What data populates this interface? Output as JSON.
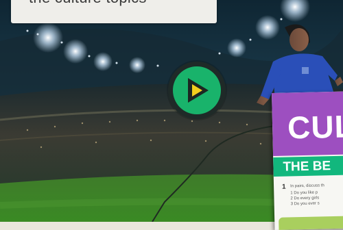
{
  "caption": {
    "text": "the culture topics"
  },
  "video": {
    "play_label": "Play video",
    "icon": "play-icon"
  },
  "card": {
    "title": "CUL",
    "subtitle": "THE BE",
    "item_number": "1",
    "lines": [
      "In pairs, discuss th",
      "1  Do you like p",
      "2  Do every girls",
      "3  Do you ever s"
    ]
  },
  "colors": {
    "play_green": "#19b36b",
    "play_arrow": "#f2cf1e",
    "card_purple": "#9d4fc0",
    "card_green": "#12b77d"
  }
}
